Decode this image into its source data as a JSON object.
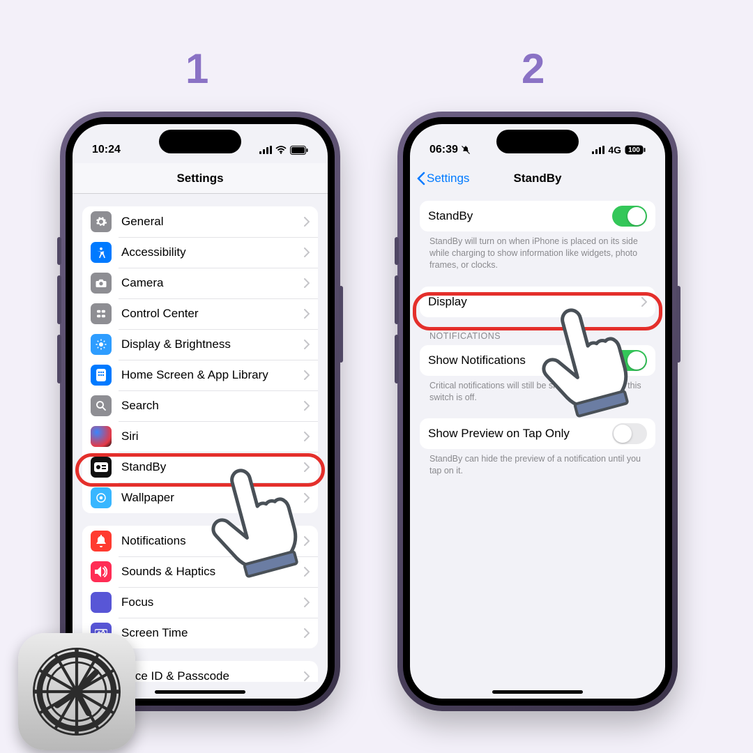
{
  "steps": {
    "one": "1",
    "two": "2"
  },
  "phone1": {
    "status": {
      "time": "10:24"
    },
    "title": "Settings",
    "rows_g1": [
      {
        "label": "General"
      },
      {
        "label": "Accessibility"
      },
      {
        "label": "Camera"
      },
      {
        "label": "Control Center"
      },
      {
        "label": "Display & Brightness"
      },
      {
        "label": "Home Screen & App Library"
      },
      {
        "label": "Search"
      },
      {
        "label": "Siri"
      },
      {
        "label": "StandBy"
      },
      {
        "label": "Wallpaper"
      }
    ],
    "rows_g2": [
      {
        "label": "Notifications"
      },
      {
        "label": "Sounds & Haptics"
      },
      {
        "label": "Focus"
      },
      {
        "label": "Screen Time"
      }
    ],
    "rows_g3": [
      {
        "label": "Face ID & Passcode"
      }
    ]
  },
  "phone2": {
    "status": {
      "time": "06:39",
      "network": "4G",
      "battery": "100"
    },
    "back": "Settings",
    "title": "StandBy",
    "section1": {
      "row_label": "StandBy",
      "footer": "StandBy will turn on when iPhone is placed on its side while charging to show information like widgets, photo frames, or clocks."
    },
    "section2": {
      "row_label": "Display"
    },
    "section3": {
      "header": "NOTIFICATIONS",
      "row_label": "Show Notifications",
      "footer": "Critical notifications will still be shown in StandBy if this switch is off."
    },
    "section4": {
      "row_label": "Show Preview on Tap Only",
      "footer": "StandBy can hide the preview of a notification until you tap on it."
    }
  }
}
